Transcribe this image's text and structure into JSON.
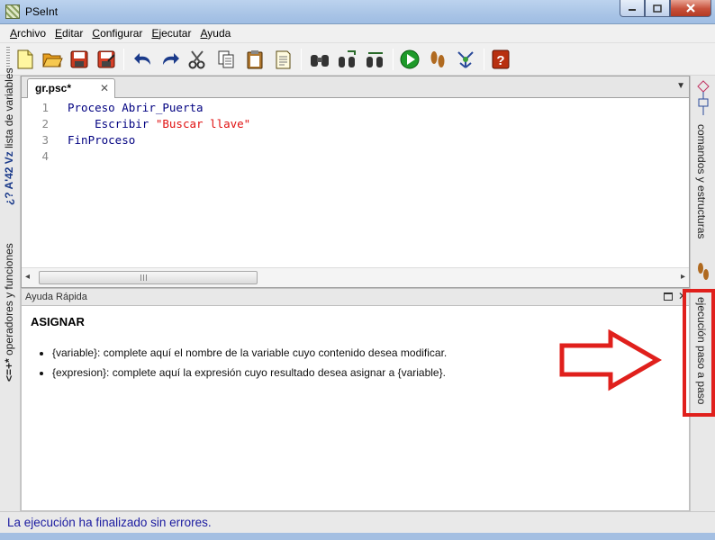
{
  "window": {
    "title": "PSeInt",
    "controls": [
      "minimize",
      "maximize",
      "close"
    ]
  },
  "menubar": {
    "items": [
      "Archivo",
      "Editar",
      "Configurar",
      "Ejecutar",
      "Ayuda"
    ]
  },
  "toolbar": {
    "buttons": [
      "new-file-icon",
      "open-folder-icon",
      "save-icon",
      "save-as-icon",
      "undo-icon",
      "redo-icon",
      "cut-icon",
      "copy-icon",
      "paste-icon",
      "document-icon",
      "find-icon",
      "find-next-icon",
      "replace-icon",
      "run-icon",
      "step-by-step-icon",
      "flowchart-icon",
      "help-icon"
    ]
  },
  "left_panel": {
    "tab_variables": "lista de variables",
    "tab_variables_glyphs": "¿? A'42 Vz",
    "tab_operators": "operadores y funciones",
    "tab_operators_glyphs": "<=+*"
  },
  "right_panel": {
    "tab_commands": "comandos y estructuras",
    "tab_step": "ejecución paso a paso"
  },
  "editor": {
    "tab_label": "gr.psc*",
    "tab_close": "✕",
    "lines": [
      {
        "num": "1",
        "keyword": "Proceso",
        "rest": " Abrir_Puerta",
        "string": ""
      },
      {
        "num": "2",
        "keyword": "    Escribir",
        "rest": " ",
        "string": "\"Buscar llave\""
      },
      {
        "num": "3",
        "keyword": "FinProceso",
        "rest": "",
        "string": ""
      },
      {
        "num": "4",
        "keyword": "",
        "rest": "",
        "string": ""
      }
    ]
  },
  "help": {
    "title": "Ayuda Rápida",
    "heading": "ASIGNAR",
    "items": [
      "{variable}: complete aquí el nombre de la variable cuyo contenido desea modificar.",
      "{expresion}: complete aquí la expresión cuyo resultado desea asignar a {variable}."
    ]
  },
  "status": {
    "text": "La ejecución ha finalizado sin errores."
  },
  "colors": {
    "keyword": "#000080",
    "string": "#e01010",
    "status_text": "#1a1aa0",
    "annotation": "#e0201c"
  }
}
